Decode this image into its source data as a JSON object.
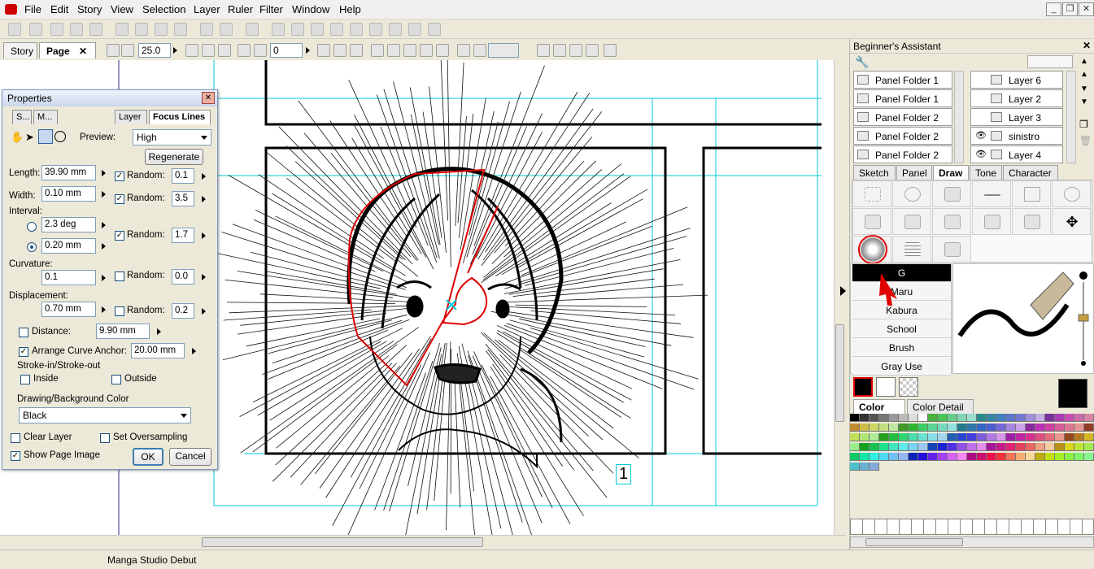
{
  "menu": [
    "File",
    "Edit",
    "Story",
    "View",
    "Selection",
    "Layer",
    "Ruler",
    "Filter",
    "Window",
    "Help"
  ],
  "doc_tabs": [
    "Story",
    "Page"
  ],
  "toolbar2": {
    "size_value": "25.0",
    "rotation_value": "0"
  },
  "status": "Manga Studio Debut",
  "page_number": "1",
  "properties": {
    "title": "Properties",
    "tabs": [
      "S...",
      "M...",
      "Layer",
      "Focus Lines"
    ],
    "preview_label": "Preview:",
    "preview_value": "High",
    "regenerate": "Regenerate",
    "length_label": "Length:",
    "length_value": "39.90 mm",
    "width_label": "Width:",
    "width_value": "0.10 mm",
    "interval_label": "Interval:",
    "interval_deg": "2.3 deg",
    "interval_mm": "0.20 mm",
    "curvature_label": "Curvature:",
    "curvature_value": "0.1",
    "displacement_label": "Displacement:",
    "displacement_value": "0.70 mm",
    "random_label": "Random:",
    "random_values": [
      "0.1",
      "3.5",
      "1.7",
      "0.0",
      "0.2"
    ],
    "distance_label": "Distance:",
    "distance_value": "9.90 mm",
    "arrange_label": "Arrange Curve Anchor:",
    "arrange_value": "20.00 mm",
    "stroke_label": "Stroke-in/Stroke-out",
    "inside_label": "Inside",
    "outside_label": "Outside",
    "drawbg_label": "Drawing/Background Color",
    "drawbg_value": "Black",
    "clear_layer": "Clear Layer",
    "set_oversampling": "Set Oversampling",
    "show_page_image": "Show Page Image",
    "ok": "OK",
    "cancel": "Cancel"
  },
  "assistant": {
    "title": "Beginner's Assistant",
    "folders": [
      "Panel Folder 1",
      "Panel Folder 1",
      "Panel Folder 2",
      "Panel Folder 2",
      "Panel Folder 2"
    ],
    "layers": [
      "Layer 6",
      "Layer 2",
      "Layer 3",
      "sinistro",
      "Layer 4"
    ],
    "draw_tabs": [
      "Sketch",
      "Panel",
      "Draw",
      "Tone",
      "Character"
    ],
    "pens": [
      "G",
      "Maru",
      "Kabura",
      "School",
      "Brush",
      "Gray Use"
    ],
    "color_tabs": [
      "Color Set",
      "Color Detail"
    ]
  },
  "colors": {
    "accent_red": "#cc0000",
    "guide_cyan": "#00c8d8",
    "selection_red": "#e00000"
  }
}
